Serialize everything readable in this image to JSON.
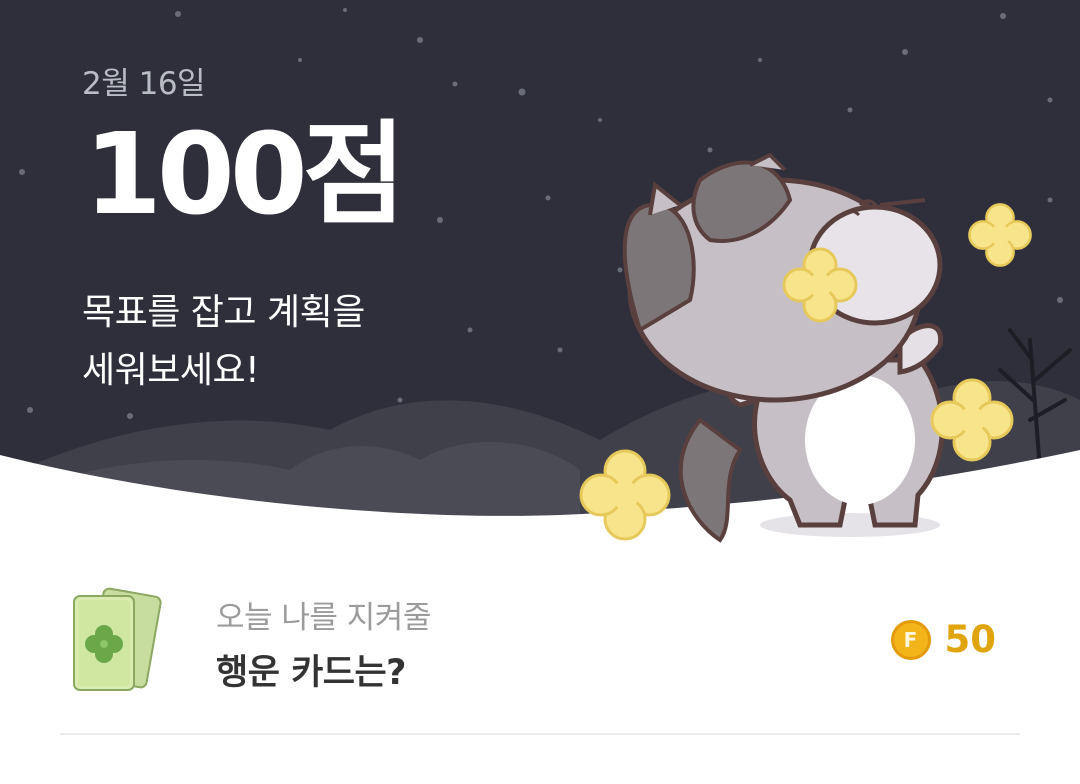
{
  "hero": {
    "date": "2월 16일",
    "score": "100점",
    "message_line1": "목표를 잡고 계획을",
    "message_line2": "세워보세요!",
    "colors": {
      "sky": "#2e2f3b",
      "hills": "#3f4049",
      "accent_flower": "#f8e58b"
    }
  },
  "card": {
    "subtitle": "오늘 나를 지켜줄",
    "title": "행운 카드는?",
    "reward_icon": "coin-icon",
    "reward_icon_letter": "F",
    "reward_value": "50",
    "colors": {
      "coin": "#f3b41a",
      "reward_text": "#e0a40c"
    }
  }
}
